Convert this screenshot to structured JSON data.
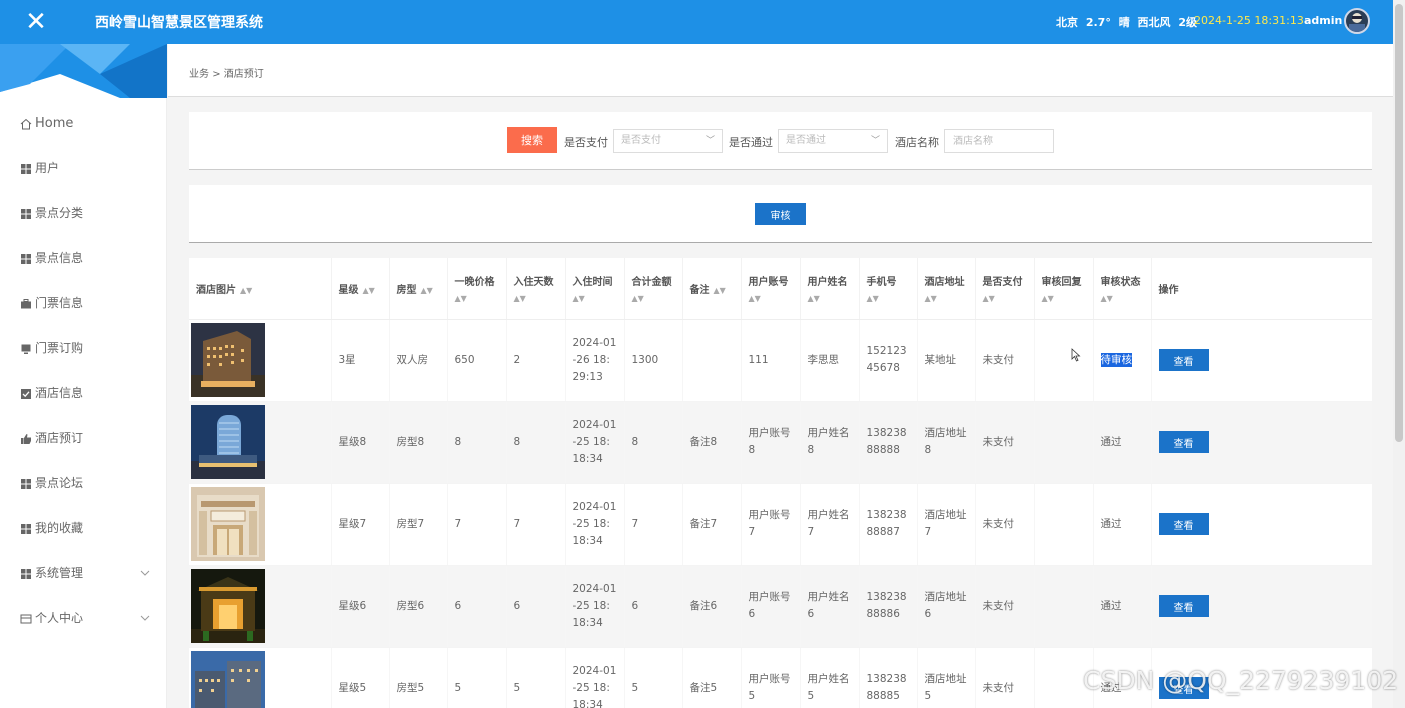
{
  "header": {
    "close_glyph": "✕",
    "app_title": "西岭雪山智慧景区管理系统",
    "weather": {
      "city": "北京",
      "temp": "2.7°",
      "condition": "晴",
      "wind": "西北风",
      "level": "2级"
    },
    "clock": "2024-1-25 18:31:13",
    "user": "admin",
    "accent": "#1e90e6"
  },
  "sidebar": {
    "items": [
      {
        "label": "Home",
        "icon": "home-icon"
      },
      {
        "label": "用户",
        "icon": "grid-icon"
      },
      {
        "label": "景点分类",
        "icon": "grid-icon"
      },
      {
        "label": "景点信息",
        "icon": "grid-icon"
      },
      {
        "label": "门票信息",
        "icon": "briefcase-icon"
      },
      {
        "label": "门票订购",
        "icon": "monitor-icon"
      },
      {
        "label": "酒店信息",
        "icon": "check-square-icon"
      },
      {
        "label": "酒店预订",
        "icon": "thumbs-up-icon"
      },
      {
        "label": "景点论坛",
        "icon": "grid-icon"
      },
      {
        "label": "我的收藏",
        "icon": "grid-icon"
      },
      {
        "label": "系统管理",
        "icon": "grid-icon"
      },
      {
        "label": "个人中心",
        "icon": "card-icon"
      }
    ]
  },
  "breadcrumb": {
    "root": "业务",
    "sep": ">",
    "current": "酒店预订"
  },
  "search": {
    "button": "搜索",
    "paid_label": "是否支付",
    "paid_placeholder": "是否支付",
    "pass_label": "是否通过",
    "pass_placeholder": "是否通过",
    "hotel_label": "酒店名称",
    "hotel_placeholder": "酒店名称"
  },
  "actions": {
    "audit": "审核"
  },
  "table": {
    "headers": {
      "image": "酒店图片",
      "star": "星级",
      "room": "房型",
      "price": "一晚价格",
      "days": "入住天数",
      "checkin": "入住时间",
      "total": "合计金额",
      "note": "备注",
      "account": "用户账号",
      "name": "用户姓名",
      "phone": "手机号",
      "address": "酒店地址",
      "paid": "是否支付",
      "reply": "审核回复",
      "status": "审核状态",
      "op": "操作"
    },
    "view_label": "查看",
    "rows": [
      {
        "star": "3星",
        "room": "双人房",
        "price": "650",
        "days": "2",
        "checkin": "2024-01-26 18:29:13",
        "total": "1300",
        "note": "",
        "account": "111",
        "name": "李思思",
        "phone": "15212345678",
        "address": "某地址",
        "paid": "未支付",
        "reply": "",
        "status": "待审核"
      },
      {
        "star": "星级8",
        "room": "房型8",
        "price": "8",
        "days": "8",
        "checkin": "2024-01-25 18:18:34",
        "total": "8",
        "note": "备注8",
        "account": "用户账号8",
        "name": "用户姓名8",
        "phone": "13823888888",
        "address": "酒店地址8",
        "paid": "未支付",
        "reply": "",
        "status": "通过"
      },
      {
        "star": "星级7",
        "room": "房型7",
        "price": "7",
        "days": "7",
        "checkin": "2024-01-25 18:18:34",
        "total": "7",
        "note": "备注7",
        "account": "用户账号7",
        "name": "用户姓名7",
        "phone": "13823888887",
        "address": "酒店地址7",
        "paid": "未支付",
        "reply": "",
        "status": "通过"
      },
      {
        "star": "星级6",
        "room": "房型6",
        "price": "6",
        "days": "6",
        "checkin": "2024-01-25 18:18:34",
        "total": "6",
        "note": "备注6",
        "account": "用户账号6",
        "name": "用户姓名6",
        "phone": "13823888886",
        "address": "酒店地址6",
        "paid": "未支付",
        "reply": "",
        "status": "通过"
      },
      {
        "star": "星级5",
        "room": "房型5",
        "price": "5",
        "days": "5",
        "checkin": "2024-01-25 18:18:34",
        "total": "5",
        "note": "备注5",
        "account": "用户账号5",
        "name": "用户姓名5",
        "phone": "13823888885",
        "address": "酒店地址5",
        "paid": "未支付",
        "reply": "",
        "status": "通过"
      }
    ]
  },
  "watermark": "CSDN @QQ_2279239102"
}
